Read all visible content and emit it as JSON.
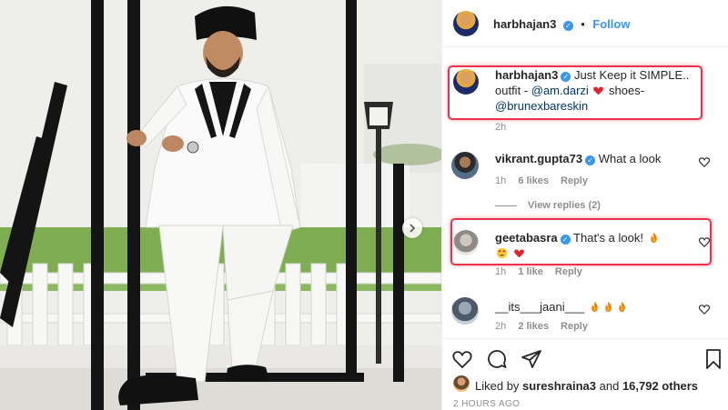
{
  "post": {
    "author": "harbhajan3",
    "follow_label": "Follow",
    "caption_lead": "Just Keep it SIMPLE..",
    "caption_mid1": "outfit -",
    "caption_mention1": "@am.darzi",
    "caption_mid2": "shoes-",
    "caption_mention2": "@brunexbareskin",
    "caption_time": "2h"
  },
  "comments": [
    {
      "user": "vikrant.gupta73",
      "text": "What a look",
      "time": "1h",
      "likes": "6 likes",
      "reply": "Reply"
    },
    {
      "user": "geetabasra",
      "text": "That's a look!",
      "time": "1h",
      "likes": "1 like",
      "reply": "Reply"
    },
    {
      "user": "__its___jaani___",
      "text": "",
      "time": "2h",
      "likes": "2 likes",
      "reply": "Reply"
    }
  ],
  "view_replies": "View replies (2)",
  "likes": {
    "prefix": "Liked by",
    "user": "sureshraina3",
    "connector": "and",
    "count": "16,792 others"
  },
  "timestamp": "2 HOURS AGO",
  "icons": [
    "heart-icon",
    "comment-icon",
    "share-icon",
    "bookmark-icon",
    "verified-icon",
    "fire-emoji",
    "heart-eyes-emoji",
    "red-heart-emoji",
    "chevron-right-icon"
  ],
  "colors": {
    "accent": "#3897f0",
    "highlight": "#e8334a",
    "muted": "#8e8e8e",
    "mention": "#00376b"
  }
}
